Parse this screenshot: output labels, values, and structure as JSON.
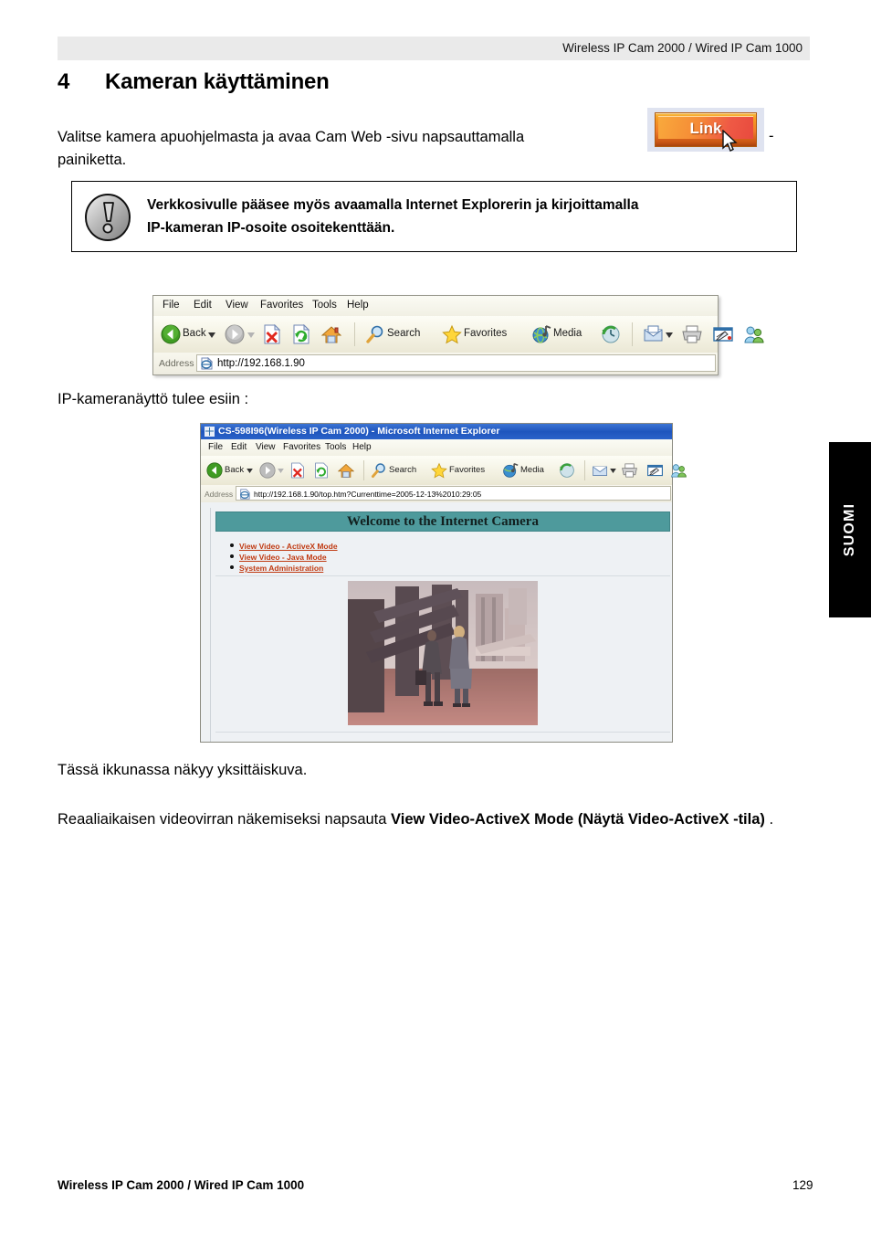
{
  "header": {
    "running_head": "Wireless IP Cam 2000 / Wired IP Cam 1000"
  },
  "chapter": {
    "number": "4",
    "title": "Kameran käyttäminen"
  },
  "intro": {
    "line1": "Valitse kamera apuohjelmasta ja avaa Cam Web -sivu napsauttamalla",
    "line2": "painiketta.",
    "dash": "-",
    "link_button_label": "Link"
  },
  "note": {
    "icon": "exclamation-circle-icon",
    "line1": "Verkkosivulle pääsee myös avaamalla Internet Explorerin ja kirjoittamalla",
    "line2": "IP-kameran IP-osoite osoitekenttään."
  },
  "browser_toolbar_shot": {
    "menu_items": [
      "File",
      "Edit",
      "View",
      "Favorites",
      "Tools",
      "Help"
    ],
    "toolbar_buttons": [
      {
        "label": "Back",
        "icon": "back-arrow-icon"
      },
      {
        "label": "",
        "icon": "forward-arrow-icon"
      },
      {
        "label": "",
        "icon": "stop-icon"
      },
      {
        "label": "",
        "icon": "refresh-icon"
      },
      {
        "label": "",
        "icon": "home-icon"
      },
      {
        "label": "Search",
        "icon": "search-icon"
      },
      {
        "label": "Favorites",
        "icon": "favorites-star-icon"
      },
      {
        "label": "Media",
        "icon": "media-globe-icon"
      },
      {
        "label": "",
        "icon": "history-clock-icon"
      },
      {
        "label": "",
        "icon": "mail-icon"
      },
      {
        "label": "",
        "icon": "print-icon"
      },
      {
        "label": "",
        "icon": "edit-icon"
      },
      {
        "label": "",
        "icon": "messenger-icon"
      }
    ],
    "address_label": "Address",
    "address_value": "http://192.168.1.90"
  },
  "camera_page_shot": {
    "window_title": "CS-598I96(Wireless IP Cam 2000) - Microsoft Internet Explorer",
    "menu_items": [
      "File",
      "Edit",
      "View",
      "Favorites",
      "Tools",
      "Help"
    ],
    "toolbar_buttons": [
      {
        "label": "Back",
        "icon": "back-arrow-icon"
      },
      {
        "label": "",
        "icon": "forward-arrow-icon"
      },
      {
        "label": "",
        "icon": "stop-icon"
      },
      {
        "label": "",
        "icon": "refresh-icon"
      },
      {
        "label": "",
        "icon": "home-icon"
      },
      {
        "label": "Search",
        "icon": "search-icon"
      },
      {
        "label": "Favorites",
        "icon": "favorites-star-icon"
      },
      {
        "label": "Media",
        "icon": "media-globe-icon"
      },
      {
        "label": "",
        "icon": "history-clock-icon"
      },
      {
        "label": "",
        "icon": "mail-icon"
      },
      {
        "label": "",
        "icon": "print-icon"
      },
      {
        "label": "",
        "icon": "edit-icon"
      },
      {
        "label": "",
        "icon": "messenger-icon"
      }
    ],
    "address_label": "Address",
    "address_value": "http://192.168.1.90/top.htm?Currenttime=2005-12-13%2010:29:05",
    "banner": "Welcome to the Internet Camera",
    "links": [
      "View Video - ActiveX Mode",
      "View Video - Java Mode",
      "System Administration"
    ],
    "banner_color": "#4e9a9c",
    "link_color": "#c03a12"
  },
  "captions": {
    "above_window": "IP-kameranäyttö tulee esiin :",
    "below_window": "Tässä ikkunassa näkyy yksittäiskuva.",
    "instruction_plain": "Reaaliaikaisen videovirran näkemiseksi napsauta ",
    "instruction_bold": "View Video-ActiveX Mode (Näytä Video-ActiveX -tila)",
    "instruction_tail": " ."
  },
  "side_tab": {
    "label": "SUOMI",
    "background": "#000000",
    "text_color": "#ffffff"
  },
  "footer": {
    "left": "Wireless IP Cam 2000 / Wired IP Cam 1000",
    "page_number": "129"
  }
}
